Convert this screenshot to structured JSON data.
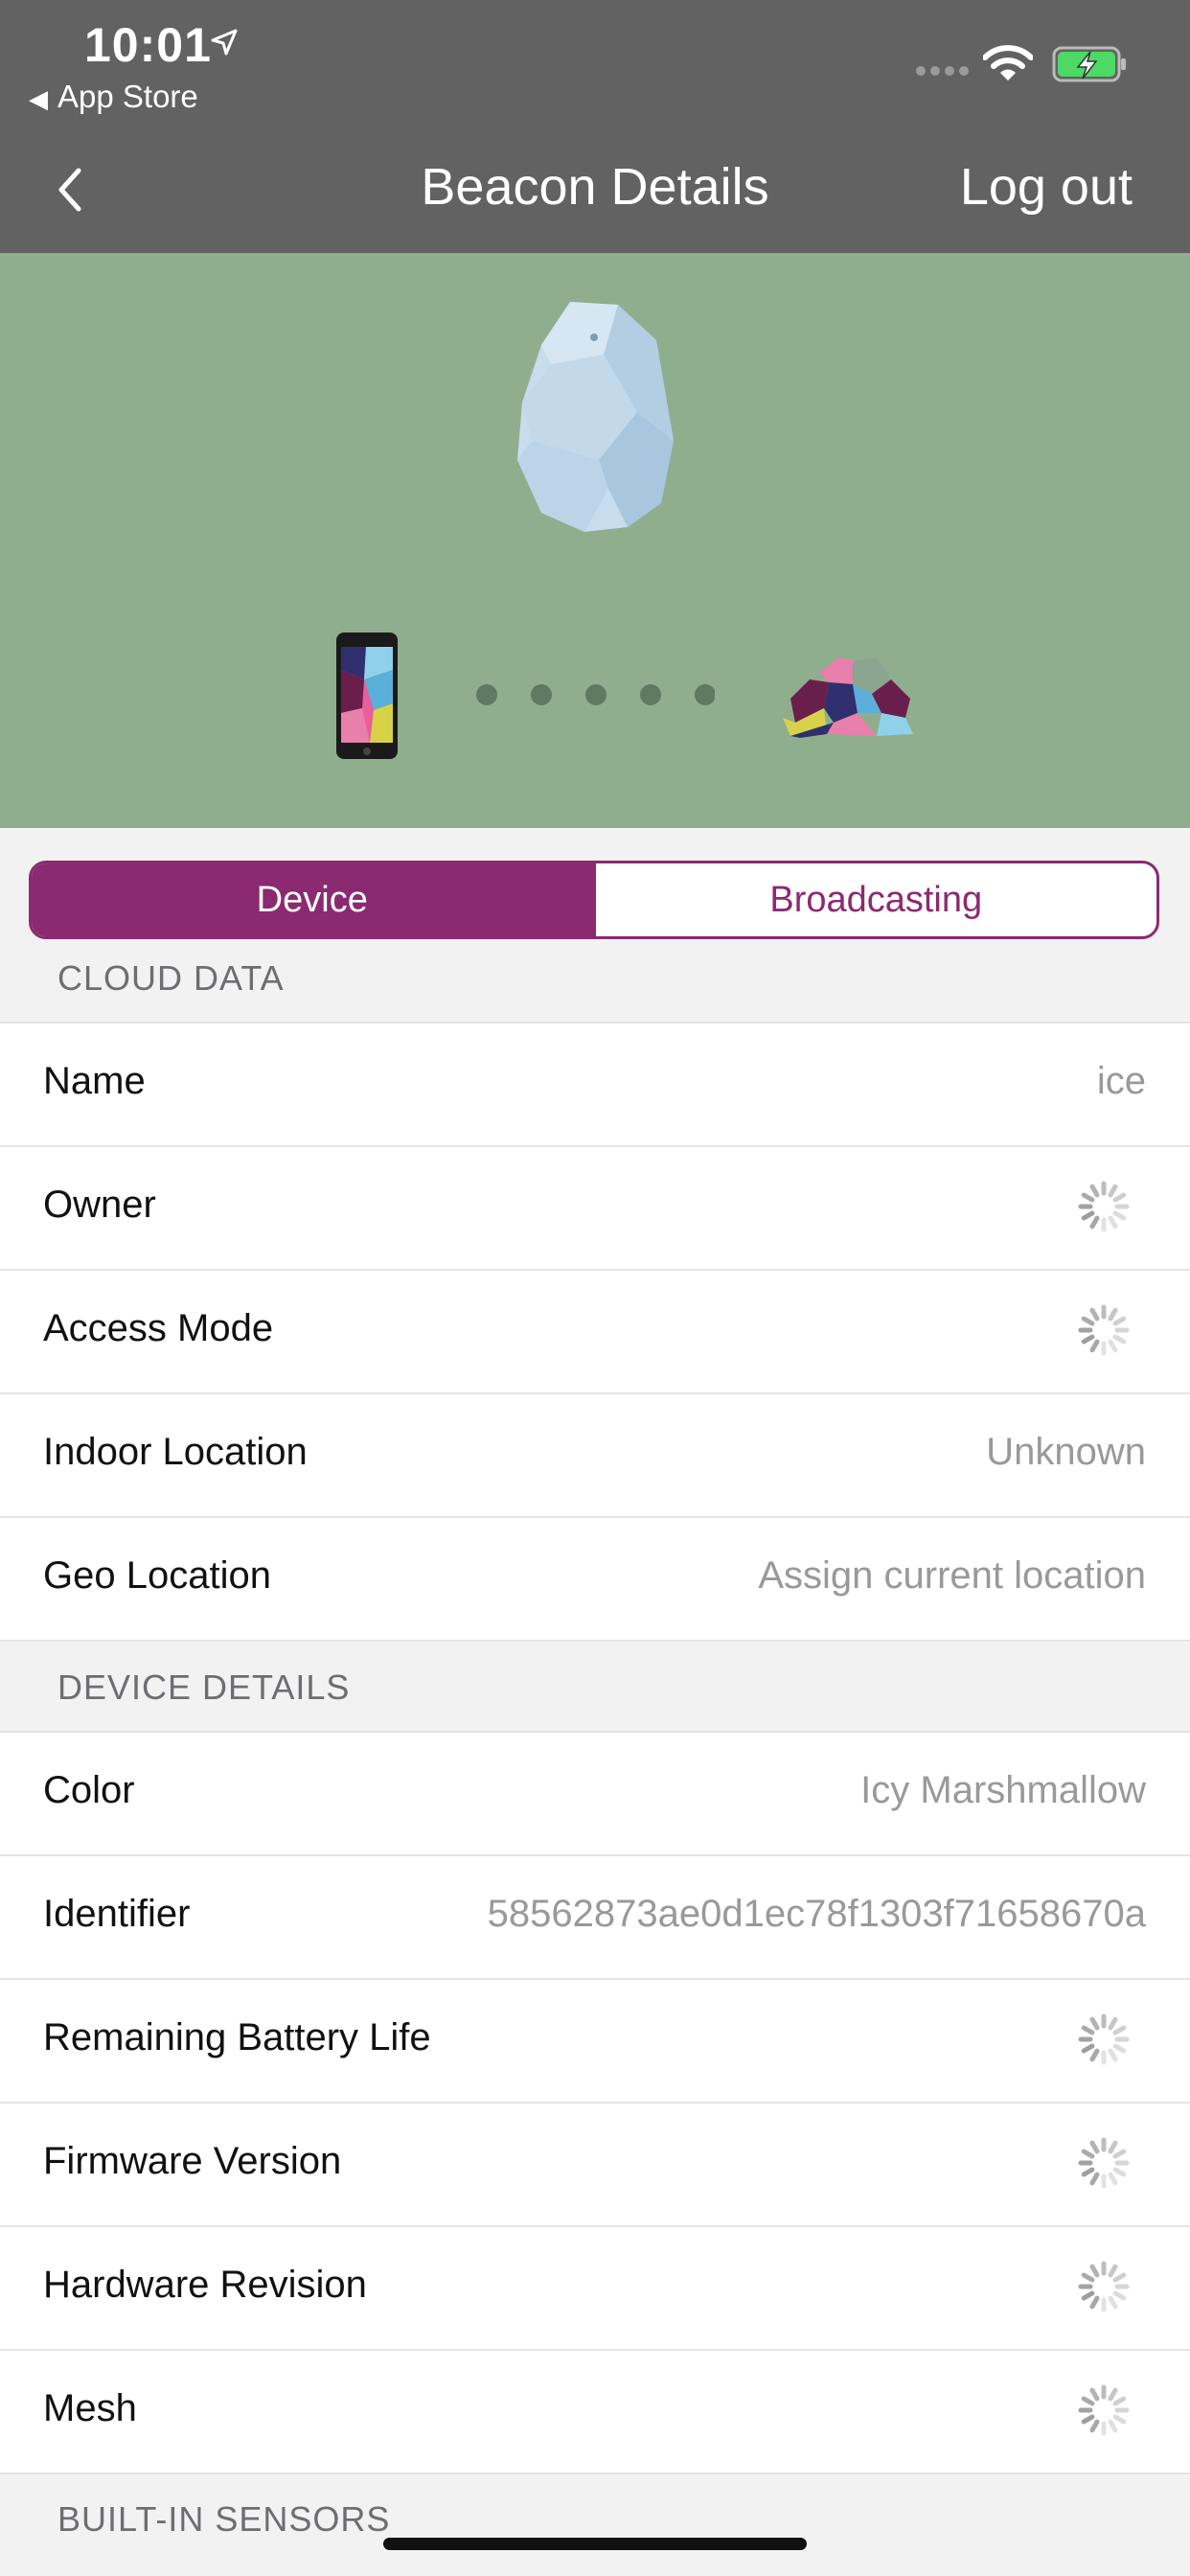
{
  "status_bar": {
    "time": "10:01",
    "back_app": "App Store"
  },
  "nav": {
    "title": "Beacon Details",
    "logout_label": "Log out"
  },
  "segments": {
    "device": "Device",
    "broadcasting": "Broadcasting"
  },
  "cloud_data": {
    "header": "CLOUD DATA",
    "rows": [
      {
        "label": "Name",
        "value": "ice"
      },
      {
        "label": "Owner",
        "value": null
      },
      {
        "label": "Access Mode",
        "value": null
      },
      {
        "label": "Indoor Location",
        "value": "Unknown"
      },
      {
        "label": "Geo Location",
        "value": "Assign current location"
      }
    ]
  },
  "device_details": {
    "header": "DEVICE DETAILS",
    "rows": [
      {
        "label": "Color",
        "value": "Icy Marshmallow"
      },
      {
        "label": "Identifier",
        "value": "58562873ae0d1ec78f1303f71658670a"
      },
      {
        "label": "Remaining Battery Life",
        "value": null
      },
      {
        "label": "Firmware Version",
        "value": null
      },
      {
        "label": "Hardware Revision",
        "value": null
      },
      {
        "label": "Mesh",
        "value": null
      }
    ]
  },
  "built_in_sensors": {
    "header": "BUILT-IN SENSORS"
  },
  "colors": {
    "accent": "#8b2a70",
    "nav_bg": "#626262",
    "hero_bg": "#8fae8e"
  }
}
